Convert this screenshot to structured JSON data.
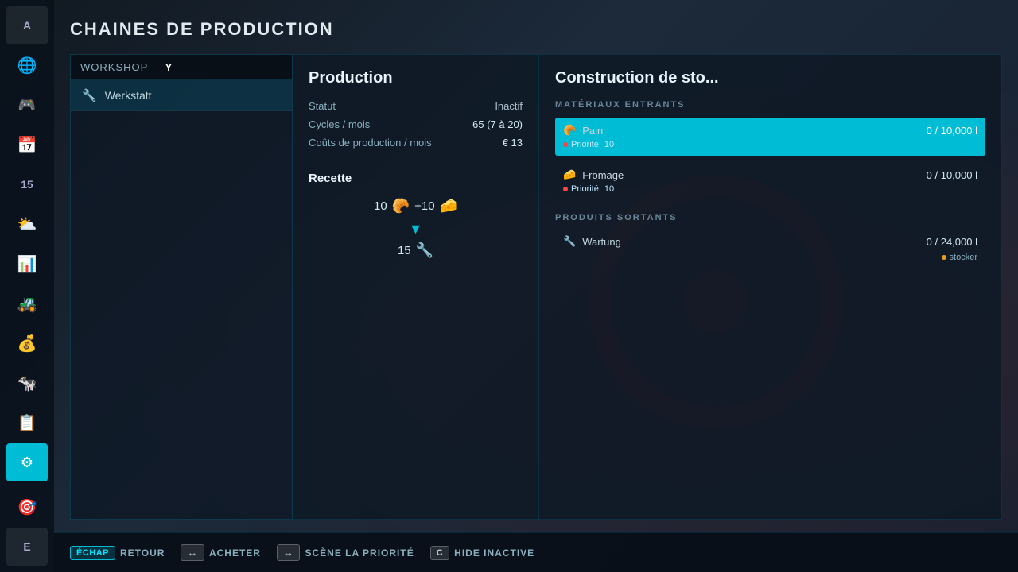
{
  "page": {
    "title": "CHAINES DE PRODUCTION",
    "bgColor": "#1a2535"
  },
  "sidebar": {
    "items": [
      {
        "id": "letter-a",
        "label": "A",
        "type": "letter",
        "active": false
      },
      {
        "id": "globe",
        "icon": "🌐",
        "active": false
      },
      {
        "id": "steering",
        "icon": "🎮",
        "active": false
      },
      {
        "id": "calendar",
        "icon": "📅",
        "active": false
      },
      {
        "id": "calendar15",
        "label": "15",
        "type": "calendar",
        "active": false
      },
      {
        "id": "weather",
        "icon": "⛅",
        "active": false
      },
      {
        "id": "chart",
        "icon": "📊",
        "active": false
      },
      {
        "id": "tractor",
        "icon": "🚜",
        "active": false
      },
      {
        "id": "money",
        "icon": "💰",
        "active": false
      },
      {
        "id": "cow",
        "icon": "🐄",
        "active": false
      },
      {
        "id": "contract",
        "icon": "📋",
        "active": false
      },
      {
        "id": "production",
        "icon": "⚙",
        "active": true
      },
      {
        "id": "bottom1",
        "icon": "🎯",
        "active": false
      },
      {
        "id": "bottom-e",
        "label": "E",
        "type": "letter",
        "active": false
      }
    ]
  },
  "workshop": {
    "header": "WORKSHOP",
    "separator": "-",
    "location": "Y",
    "items": [
      {
        "id": "werkstatt",
        "name": "Werkstatt",
        "selected": true
      }
    ]
  },
  "production": {
    "title": "Production",
    "fields": [
      {
        "label": "Statut",
        "value": "Inactif"
      },
      {
        "label": "Cycles / mois",
        "value": "65 (7 à 20)"
      },
      {
        "label": "Coûts de production / mois",
        "value": "€ 13"
      }
    ],
    "recipe": {
      "title": "Recette",
      "ingredients": [
        {
          "amount": "10",
          "icon": "🥐"
        },
        {
          "plus": "+",
          "amount": "10",
          "icon": "🧀"
        }
      ],
      "arrow": "▼",
      "output_amount": "15",
      "output_icon": "🔧"
    }
  },
  "construction": {
    "title": "Construction de sto...",
    "incoming_label": "MATÉRIAUX ENTRANTS",
    "incoming_items": [
      {
        "id": "pain",
        "name": "Pain",
        "icon": "🥐",
        "current": 0,
        "max": "10,000",
        "unit": "l",
        "priority_label": "Priorité:",
        "priority_value": 10,
        "selected": true
      },
      {
        "id": "fromage",
        "name": "Fromage",
        "icon": "🧀",
        "current": 0,
        "max": "10,000",
        "unit": "l",
        "priority_label": "Priorité:",
        "priority_value": 10,
        "selected": false
      }
    ],
    "outgoing_label": "PRODUITS SORTANTS",
    "outgoing_items": [
      {
        "id": "wartung",
        "name": "Wartung",
        "icon": "🔧",
        "current": 0,
        "max": "24,000",
        "unit": "l",
        "store_label": "stocker"
      }
    ]
  },
  "bottom_bar": {
    "buttons": [
      {
        "key": "ÉCHAP",
        "label": "RETOUR",
        "style": "echap"
      },
      {
        "key": "↔",
        "label": "ACHETER",
        "style": "arrow"
      },
      {
        "key": "↔",
        "label": "SCÈNE LA PRIORITÉ",
        "style": "arrow"
      },
      {
        "key": "C",
        "label": "HIDE INACTIVE",
        "style": "normal"
      }
    ]
  }
}
